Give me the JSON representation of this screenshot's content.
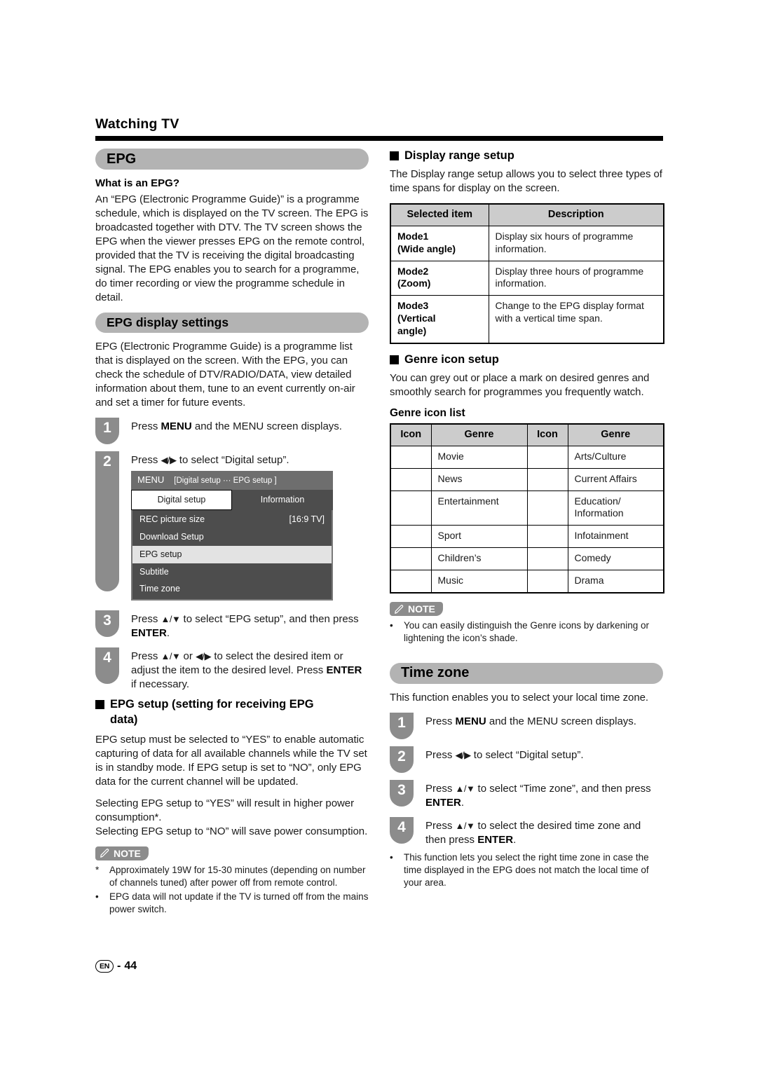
{
  "header": {
    "running_head": "Watching TV"
  },
  "left": {
    "epg_pill": "EPG",
    "what_is_head": "What is an EPG?",
    "what_is_body": "An “EPG (Electronic Programme Guide)” is a programme schedule, which is displayed on the TV screen. The EPG is broadcasted together with DTV. The TV screen shows the EPG when the viewer presses EPG on the remote control, provided that the TV is receiving the digital broadcasting signal. The EPG enables you to search for a programme, do timer recording or view the programme schedule in detail.",
    "display_settings_pill": "EPG display settings",
    "display_settings_body": "EPG (Electronic Programme Guide) is a programme list that is displayed on the screen. With the EPG, you can check the schedule of DTV/RADIO/DATA, view detailed information about them, tune to an event currently on-air and set a timer for future events.",
    "steps": [
      {
        "num": "1",
        "text": "Press MENU and the MENU screen displays."
      },
      {
        "num": "2",
        "text": "Press ◀/▶ to select “Digital setup”."
      },
      {
        "num": "3",
        "text": "Press ▲/▼ to select “EPG setup”, and then press ENTER."
      },
      {
        "num": "4",
        "text": "Press ▲/▼ or ◀/▶ to select the desired item or adjust the item to the desired level. Press ENTER if necessary."
      }
    ],
    "tv_menu": {
      "title_label": "MENU",
      "title_path": "[Digital setup ··· EPG setup ]",
      "tabs": [
        {
          "label": "Digital setup",
          "active": true
        },
        {
          "label": "Information",
          "active": false
        }
      ],
      "rows": [
        {
          "label": "REC picture size",
          "value": "[16:9 TV]",
          "selected": false
        },
        {
          "label": "Download Setup",
          "value": "",
          "selected": false
        },
        {
          "label": "EPG setup",
          "value": "",
          "selected": true
        },
        {
          "label": "Subtitle",
          "value": "",
          "selected": false
        },
        {
          "label": "Time zone",
          "value": "",
          "selected": false
        }
      ]
    },
    "epg_setup_head_line1": "EPG setup (setting for receiving EPG",
    "epg_setup_head_line2": "data)",
    "epg_setup_body1": "EPG setup must be selected to “YES” to enable automatic capturing of data for all available channels while the TV set is in standby mode. If EPG setup is set to “NO”, only EPG data for the current channel will be updated.",
    "epg_setup_body2a": "Selecting EPG setup to “YES” will result in higher power consumption*.",
    "epg_setup_body2b": "Selecting EPG setup to “NO” will save power consumption.",
    "note_label": "NOTE",
    "notes": [
      {
        "marker": "*",
        "text": "Approximately 19W for 15-30 minutes (depending on number of channels tuned) after power off from remote control."
      },
      {
        "marker": "•",
        "text": "EPG data will not update if the TV is turned off from the mains power switch."
      }
    ]
  },
  "right": {
    "display_range_head": "Display range setup",
    "display_range_body": "The Display range setup allows you to select three types of time spans for display on the screen.",
    "display_range_table": {
      "headers": [
        "Selected item",
        "Description"
      ],
      "rows": [
        {
          "item": "Mode1\n(Wide angle)",
          "desc": "Display six hours of programme information."
        },
        {
          "item": "Mode2\n(Zoom)",
          "desc": "Display three hours of programme information."
        },
        {
          "item": "Mode3\n(Vertical\nangle)",
          "desc": "Change to the EPG display format with a vertical time span."
        }
      ]
    },
    "genre_head": "Genre icon setup",
    "genre_body": "You can grey out or place a mark on desired genres and smoothly search for programmes you frequently watch.",
    "genre_list_head": "Genre icon list",
    "genre_table": {
      "headers": [
        "Icon",
        "Genre",
        "Icon",
        "Genre"
      ],
      "rows": [
        {
          "icon_left": "",
          "genre_left": "Movie",
          "icon_right": "",
          "genre_right": "Arts/Culture"
        },
        {
          "icon_left": "",
          "genre_left": "News",
          "icon_right": "",
          "genre_right": "Current Affairs"
        },
        {
          "icon_left": "",
          "genre_left": "Entertainment",
          "icon_right": "",
          "genre_right": "Education/\nInformation"
        },
        {
          "icon_left": "",
          "genre_left": "Sport",
          "icon_right": "",
          "genre_right": "Infotainment"
        },
        {
          "icon_left": "",
          "genre_left": "Children’s",
          "icon_right": "",
          "genre_right": "Comedy"
        },
        {
          "icon_left": "",
          "genre_left": "Music",
          "icon_right": "",
          "genre_right": "Drama"
        }
      ]
    },
    "note_label": "NOTE",
    "notes": [
      {
        "marker": "•",
        "text": "You can easily distinguish the Genre icons by darkening or lightening the icon’s shade."
      }
    ],
    "time_zone_pill": "Time zone",
    "time_zone_body": "This function enables you to select your local time zone.",
    "steps": [
      {
        "num": "1",
        "text": "Press MENU and the MENU screen displays."
      },
      {
        "num": "2",
        "text": "Press ◀/▶ to select “Digital setup”."
      },
      {
        "num": "3",
        "text": "Press ▲/▼ to select “Time zone”, and then press ENTER."
      },
      {
        "num": "4",
        "text": "Press ▲/▼ to select the desired time zone and then press ENTER."
      }
    ],
    "closing_notes": [
      {
        "marker": "•",
        "text": "This function lets you select the right time zone in case the time displayed in the EPG does not match the local time of your area."
      }
    ]
  },
  "footer": {
    "lang": "EN",
    "separator": "-",
    "page": "44"
  }
}
